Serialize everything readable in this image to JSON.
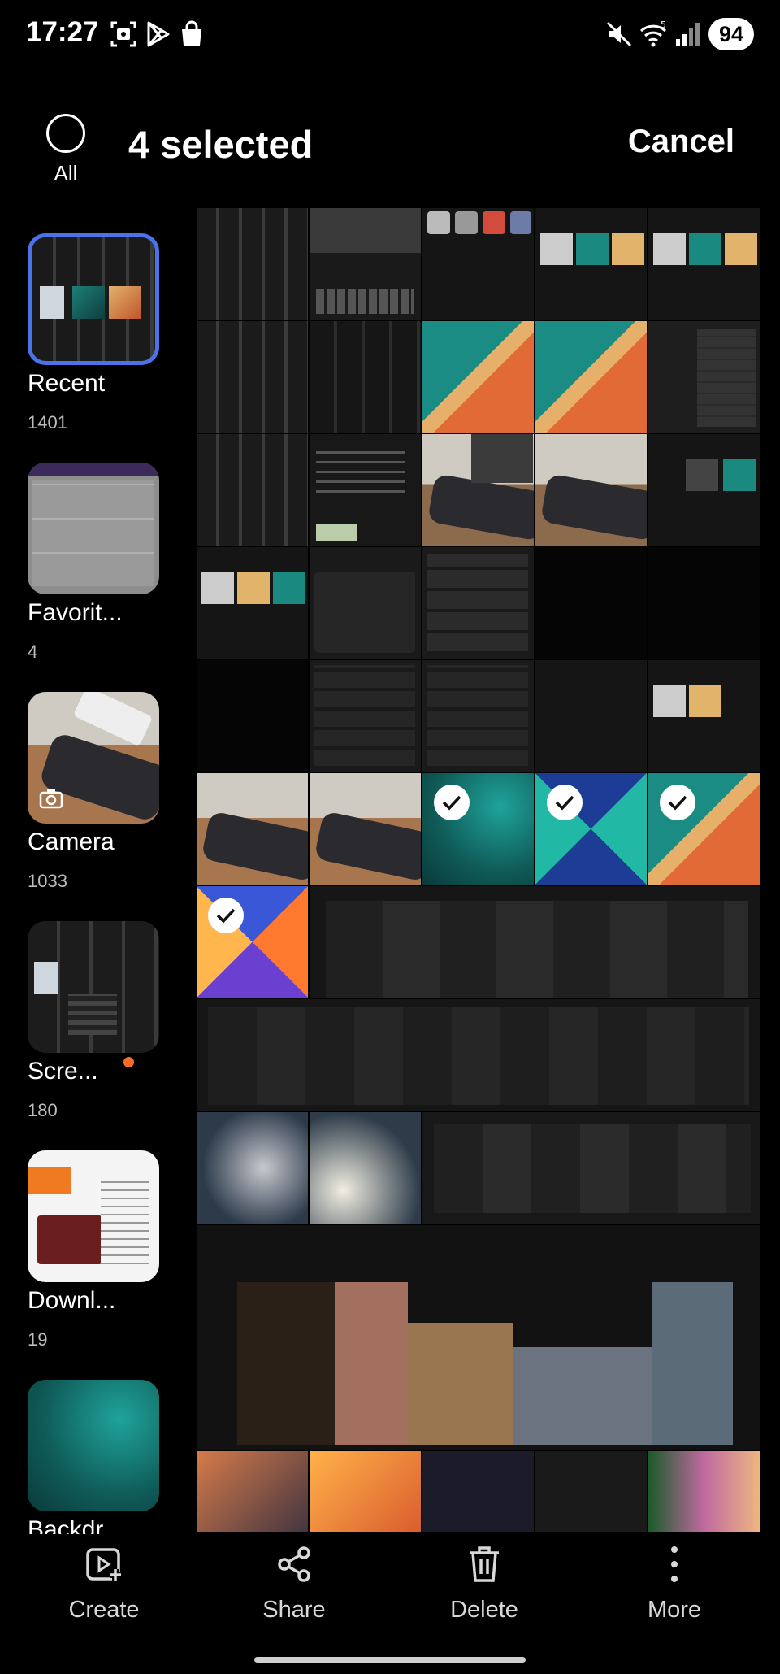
{
  "status_bar": {
    "time": "17:27",
    "battery": "94"
  },
  "header": {
    "all_label": "All",
    "title": "4 selected",
    "cancel": "Cancel"
  },
  "albums": [
    {
      "name": "Recent",
      "count": "1401"
    },
    {
      "name": "Favorit...",
      "count": "4"
    },
    {
      "name": "Camera",
      "count": "1033"
    },
    {
      "name": "Scre...",
      "count": "180"
    },
    {
      "name": "Downl...",
      "count": "19"
    },
    {
      "name": "Backdr..."
    }
  ],
  "grid": {
    "columns": 5,
    "selected_count": 4
  },
  "bottom_bar": {
    "create": "Create",
    "share": "Share",
    "delete": "Delete",
    "more": "More"
  },
  "colors": {
    "selection_border": "#4a73e8",
    "new_badge": "#ff6a28",
    "background": "#000000"
  },
  "icons": [
    "capture-icon",
    "play-store-icon",
    "shopping-bag-icon",
    "mute-icon",
    "wifi-icon",
    "signal-icon",
    "add-video-icon",
    "share-icon",
    "trash-icon",
    "more-vertical-icon",
    "camera-icon",
    "check-icon"
  ]
}
